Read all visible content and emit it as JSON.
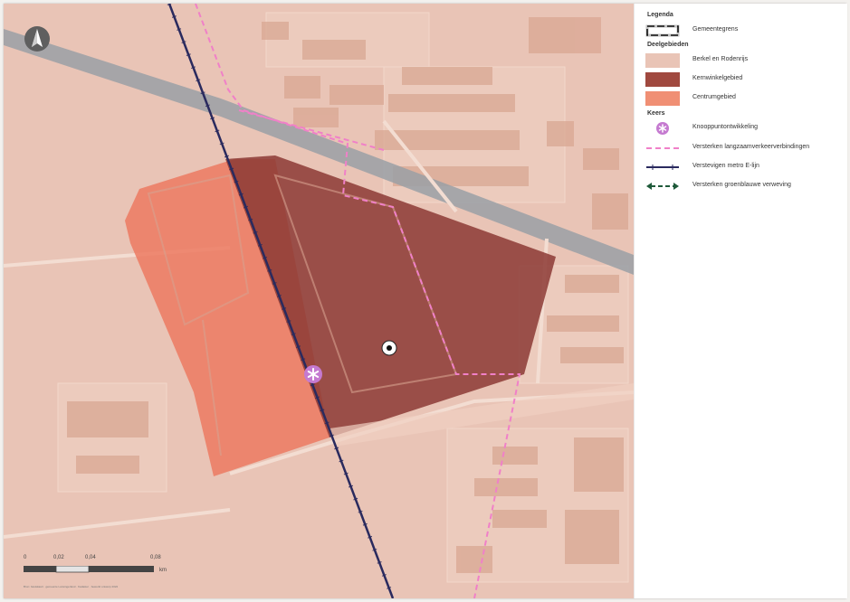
{
  "legend": {
    "title": "Legenda",
    "gemeentegrens": "Gemeentegrens",
    "section_deelgebieden": "Deelgebieden",
    "deelgebieden": [
      {
        "label": "Berkel en Rodenrijs",
        "color": "#e9c4b6"
      },
      {
        "label": "Kernwinkelgebied",
        "color": "#a0493f"
      },
      {
        "label": "Centrumgebied",
        "color": "#f08f74"
      }
    ],
    "section_keers": "Keers",
    "keers": [
      {
        "label": "Knooppuntontwikkeling",
        "icon": "knooppunt-icon",
        "color": "#c57ad0"
      },
      {
        "label": "Versterken langzaamverkeerverbindingen",
        "icon": "pink-dashed-line-icon",
        "color": "#f080c8"
      },
      {
        "label": "Verstevigen metro E-lijn",
        "icon": "metro-line-icon",
        "color": "#2a2a5e"
      },
      {
        "label": "Versterken groenblauwe verweving",
        "icon": "green-dashed-arrow-icon",
        "color": "#1f5a3a"
      }
    ]
  },
  "scale": {
    "ticks": [
      "0",
      "0,02",
      "0,04",
      "0,08"
    ],
    "unit": "km",
    "credit": "Bron: basiskaart · gemeente Lansingerland · Kadaster · bewerkt ontwerp 2022"
  },
  "map": {
    "north_icon": "north-arrow-icon",
    "colors": {
      "base": "#e9c4b6",
      "kernwinkel": "#8c3a35",
      "centrum": "#ec7a62",
      "road": "#9aa0a6",
      "metro": "#2a2a5e",
      "slow_traffic": "#f080c8"
    }
  }
}
